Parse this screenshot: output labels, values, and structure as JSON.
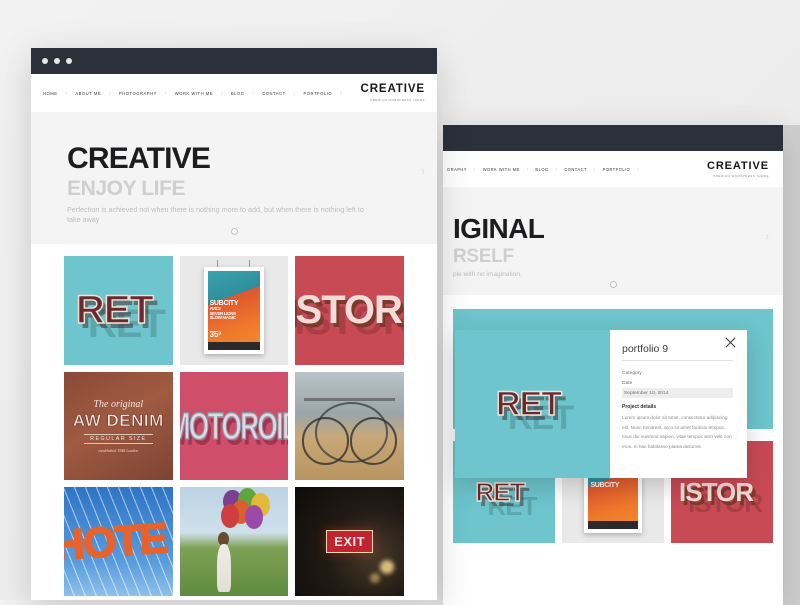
{
  "background_color": "#efefef",
  "windows": [
    {
      "id": "front-window",
      "titlebar": {
        "color": "#2b303a",
        "dots": [
          "close-dot",
          "minimize-dot",
          "maximize-dot"
        ]
      },
      "nav": {
        "items": [
          "HOME",
          "ABOUT ME",
          "PHOTOGRAPHY",
          "WORK WITH ME",
          "BLOG",
          "CONTACT",
          "PORTFOLIO"
        ],
        "separator": "/"
      },
      "logo": {
        "brand": "CREATIVE",
        "tagline": "PREMIUM WORDPRESS THEME"
      },
      "hero": {
        "title": "CREATIVE",
        "subtitle": "ENJOY LIFE",
        "description": "Perfection is achieved not when there is nothing more to add, but when there is nothing left to take away",
        "next_arrow": "›",
        "pagination_dots": 1
      },
      "portfolio": {
        "tiles": [
          {
            "name": "retro-typography",
            "text": "RET",
            "bg": "#6ec5cd"
          },
          {
            "name": "concert-poster",
            "headline": "SUBCITY",
            "line2": "AVICII",
            "line3": "SEVEN LIONS",
            "line4": "SLOW MAGIC",
            "price": "35³"
          },
          {
            "name": "history-typography",
            "text": "ISTOR",
            "bg": "#c84a55"
          },
          {
            "name": "raw-denim-label",
            "script": "The original",
            "text": "AW DENIM",
            "sub": "REGULAR SIZE",
            "footer": "established 1948 London"
          },
          {
            "name": "motoroid-typography",
            "text": "MOTOROID",
            "bg": "#cf4f6b"
          },
          {
            "name": "vintage-bicycle-photo",
            "text": ""
          },
          {
            "name": "hotel-neon-sign",
            "text": "HOTE"
          },
          {
            "name": "girl-with-balloons-photo",
            "text": ""
          },
          {
            "name": "exit-sign-photo",
            "text": "EXIT"
          }
        ]
      }
    },
    {
      "id": "back-window",
      "titlebar": {
        "color": "#2b303a"
      },
      "nav": {
        "items": [
          "GRAPHY",
          "WORK WITH ME",
          "BLOG",
          "CONTACT",
          "PORTFOLIO"
        ],
        "separator": "/"
      },
      "logo": {
        "brand": "CREATIVE",
        "tagline": "PREMIUM WORDPRESS THEME"
      },
      "hero": {
        "title": "IGINAL",
        "subtitle": "RSELF",
        "description": "ple with no imagination.",
        "next_arrow": "›",
        "pagination_dots": 1
      }
    }
  ],
  "lightbox": {
    "title": "portfolio 9",
    "category_label": "Category",
    "date_label": "Date",
    "date_value": "September 10, 2014",
    "details_heading": "Project details",
    "details_body": "Lorem ipsum dolor sit amet, consectetur adipiscing elit. Nunc hendrerit, arcu sit amet facilisis tempus, risus dui euismod sapien, vitae tempus sem velit non eros. In hac habitasse platea dictumst.",
    "close_label": "×",
    "image_name": "retro-typography"
  }
}
